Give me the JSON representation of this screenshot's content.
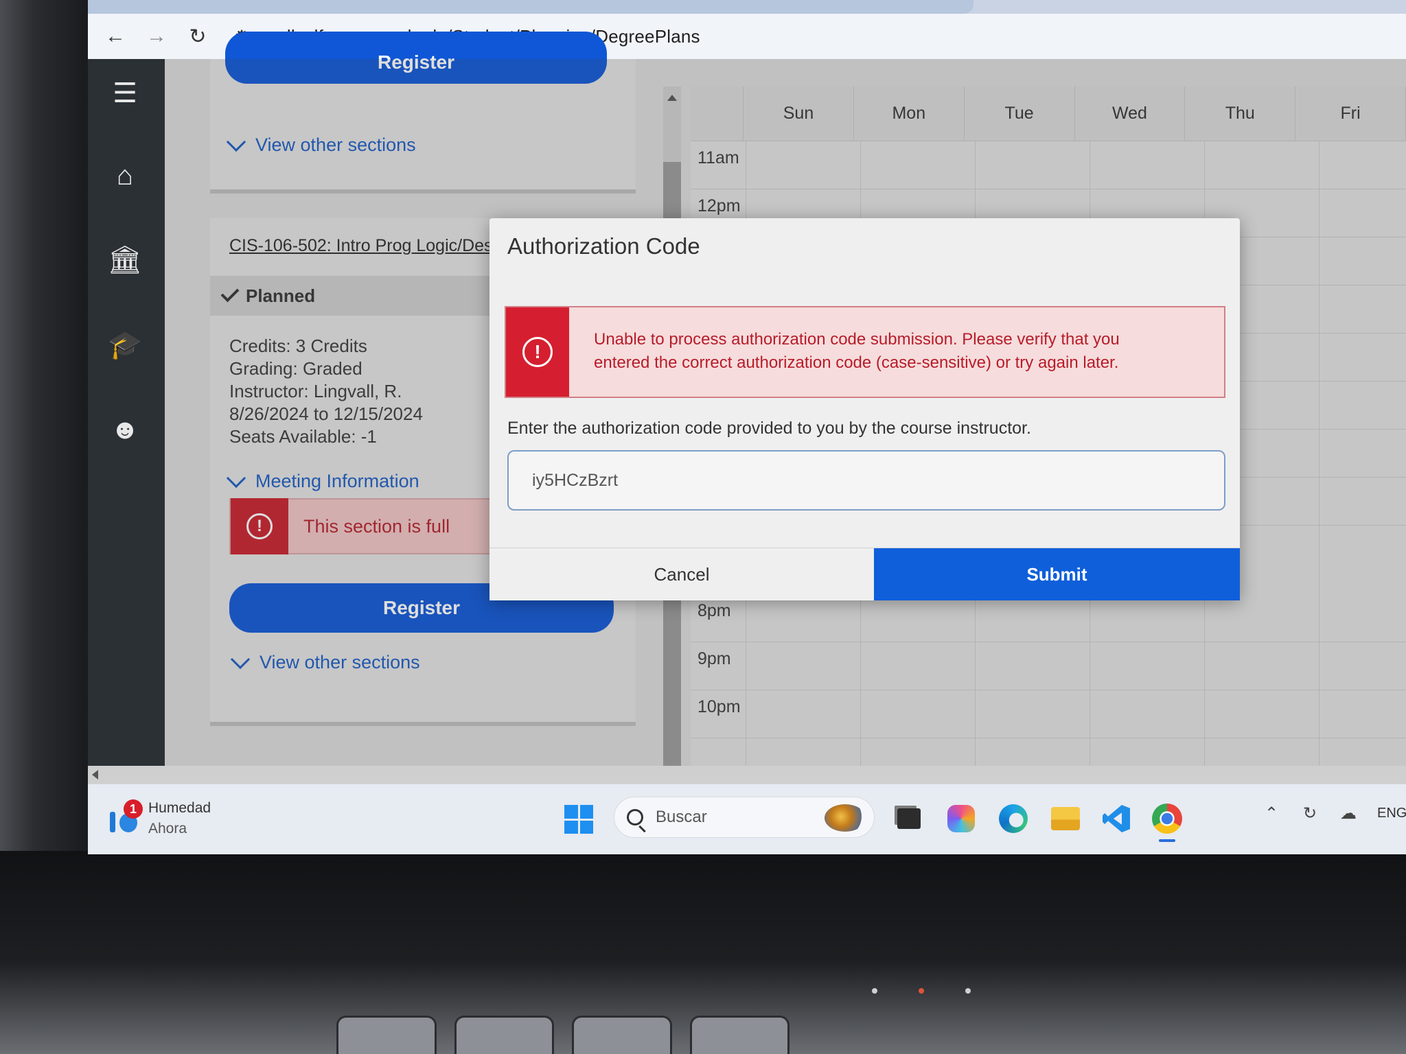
{
  "browser": {
    "url": "collselfserv.swccd.edu/Student/Planning/DegreePlans",
    "back_icon": "arrow-left-icon",
    "forward_icon": "arrow-right-icon",
    "reload_icon": "reload-icon"
  },
  "app_nav": {
    "items": [
      "menu-icon",
      "home-icon",
      "finance-icon",
      "academics-icon",
      "profile-icon"
    ]
  },
  "top_section": {
    "register_label": "Register",
    "view_other_sections": "View other sections"
  },
  "course": {
    "title": "CIS-106-502: Intro Prog Logic/Design",
    "status": "Planned",
    "credits": "Credits: 3 Credits",
    "grading": "Grading: Graded",
    "instructor": "Instructor: Lingvall, R.",
    "dates": "8/26/2024 to 12/15/2024",
    "seats": "Seats Available:  -1",
    "meeting_info": "Meeting Information",
    "full_message": "This section is full",
    "register_label": "Register",
    "view_other_sections": "View other sections"
  },
  "calendar": {
    "days": [
      "Sun",
      "Mon",
      "Tue",
      "Wed",
      "Thu",
      "Fri"
    ],
    "times": [
      "11am",
      "12pm",
      "8pm",
      "9pm",
      "10pm"
    ]
  },
  "modal": {
    "title": "Authorization Code",
    "error_line1": "Unable to process authorization code submission. Please verify that you",
    "error_line2": "entered the correct authorization code (case-sensitive) or try again later.",
    "instruction": "Enter the authorization code provided to you by the course instructor.",
    "code_value": "iy5HCzBzrt",
    "cancel_label": "Cancel",
    "submit_label": "Submit"
  },
  "taskbar": {
    "weather_badge": "1",
    "weather_title": "Humedad",
    "weather_sub": "Ahora",
    "search_placeholder": "Buscar",
    "language": "ENG"
  },
  "colors": {
    "accent_blue": "#0f57d6",
    "error_red": "#c9202c",
    "nav_dark": "#2b3035"
  }
}
